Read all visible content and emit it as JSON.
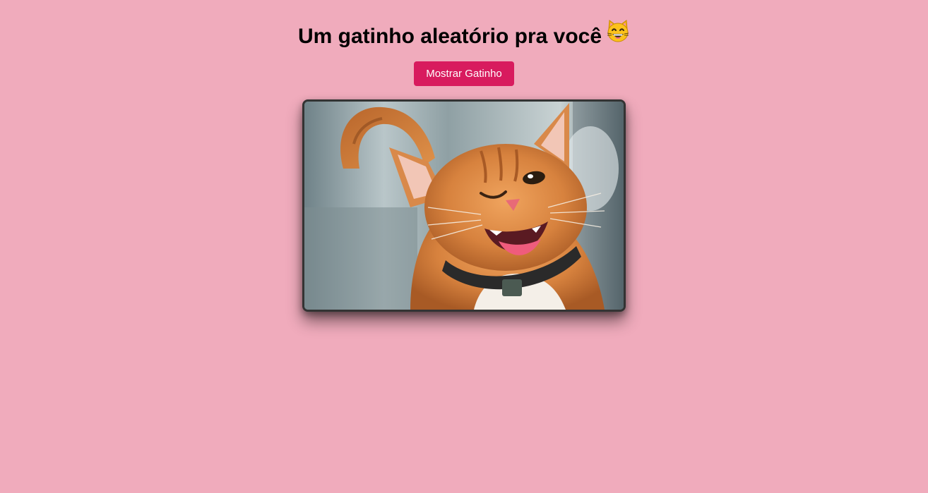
{
  "header": {
    "title": "Um gatinho aleatório pra você"
  },
  "actions": {
    "show_cat_label": "Mostrar Gatinho"
  },
  "photo": {
    "icon": "cat-photo"
  },
  "colors": {
    "background": "#f0abbc",
    "button": "#d81b5e",
    "button_text": "#ffffff",
    "title_text": "#000000",
    "frame_border": "#333333"
  }
}
